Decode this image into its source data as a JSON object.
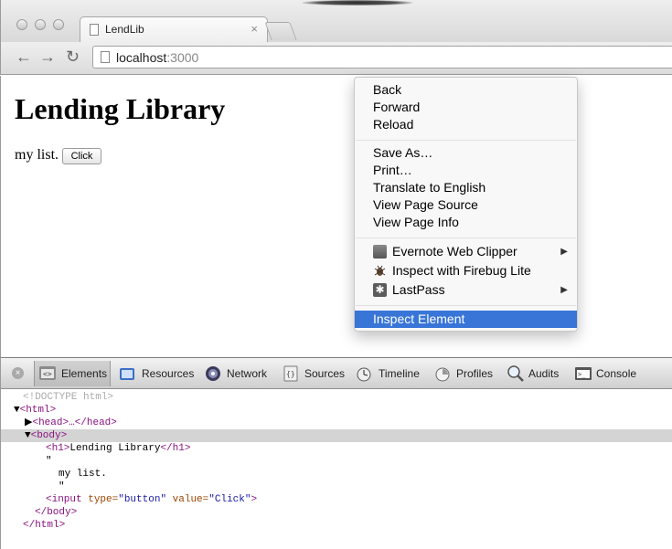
{
  "browser": {
    "tab_title": "LendLib",
    "tab_close": "×",
    "url_host": "localhost",
    "url_port": ":3000",
    "back_glyph": "←",
    "forward_glyph": "→",
    "reload_glyph": "↻"
  },
  "page": {
    "heading": "Lending Library",
    "text": "my list.",
    "button_label": "Click"
  },
  "context_menu": {
    "items": [
      {
        "label": "Back"
      },
      {
        "label": "Forward"
      },
      {
        "label": "Reload"
      },
      {
        "label": "Save As…"
      },
      {
        "label": "Print…"
      },
      {
        "label": "Translate to English"
      },
      {
        "label": "View Page Source"
      },
      {
        "label": "View Page Info"
      },
      {
        "label": "Evernote Web Clipper",
        "icon": "evernote-icon",
        "submenu": true
      },
      {
        "label": "Inspect with Firebug Lite",
        "icon": "firebug-icon",
        "submenu": false
      },
      {
        "label": "LastPass",
        "icon": "lastpass-icon",
        "submenu": true
      },
      {
        "label": "Inspect Element",
        "highlighted": true
      }
    ],
    "submenu_glyph": "▶",
    "highlight_color": "#3875d7"
  },
  "devtools": {
    "close_glyph": "×",
    "tabs": [
      {
        "label": "Elements",
        "icon": "elements-icon",
        "active": true
      },
      {
        "label": "Resources",
        "icon": "resources-icon"
      },
      {
        "label": "Network",
        "icon": "network-icon"
      },
      {
        "label": "Sources",
        "icon": "sources-icon"
      },
      {
        "label": "Timeline",
        "icon": "timeline-icon"
      },
      {
        "label": "Profiles",
        "icon": "profiles-icon"
      },
      {
        "label": "Audits",
        "icon": "audits-icon"
      },
      {
        "label": "Console",
        "icon": "console-icon"
      }
    ],
    "dom": {
      "doctype": "<!DOCTYPE html>",
      "html_open": "<html>",
      "head": "<head>…</head>",
      "body_open": "<body>",
      "h1_open": "<h1>",
      "h1_text": "Lending Library",
      "h1_close": "</h1>",
      "quote": "\"",
      "text_node": "my list.",
      "input_open": "<input ",
      "input_attr1": "type=",
      "input_val1": "\"button\"",
      "input_attr2": "value=",
      "input_val2": "\"Click\"",
      "input_close": ">",
      "body_close": "</body>",
      "html_close": "</html>",
      "expanded_glyph": "▼",
      "collapsed_glyph": "▶"
    }
  }
}
